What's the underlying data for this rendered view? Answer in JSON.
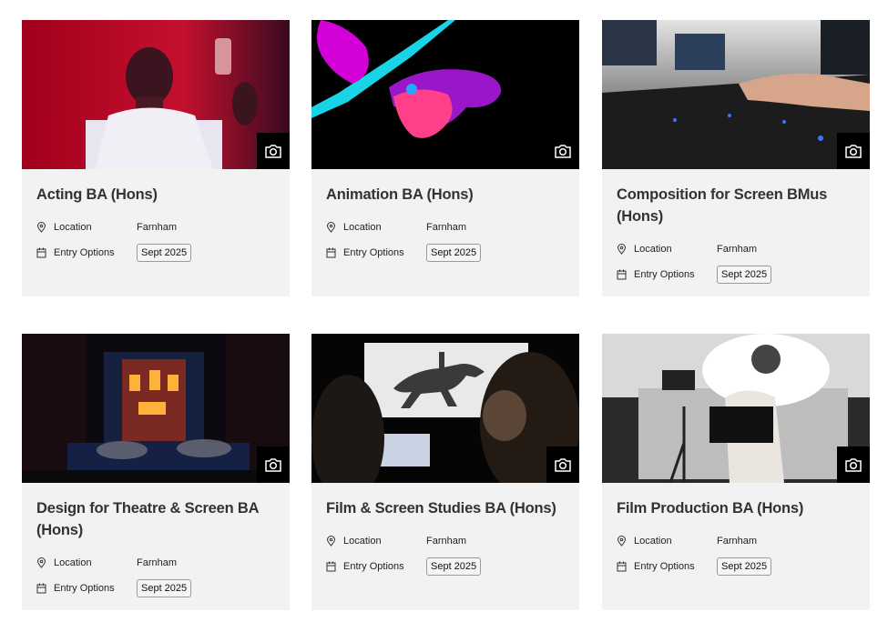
{
  "courses": [
    {
      "title": "Acting BA (Hons)",
      "location_label": "Location",
      "location_value": "Farnham",
      "entry_label": "Entry Options",
      "entry_value": "Sept 2025"
    },
    {
      "title": "Animation BA (Hons)",
      "location_label": "Location",
      "location_value": "Farnham",
      "entry_label": "Entry Options",
      "entry_value": "Sept 2025"
    },
    {
      "title": "Composition for Screen BMus (Hons)",
      "location_label": "Location",
      "location_value": "Farnham",
      "entry_label": "Entry Options",
      "entry_value": "Sept 2025"
    },
    {
      "title": "Design for Theatre & Screen BA (Hons)",
      "location_label": "Location",
      "location_value": "Farnham",
      "entry_label": "Entry Options",
      "entry_value": "Sept 2025"
    },
    {
      "title": "Film & Screen Studies BA (Hons)",
      "location_label": "Location",
      "location_value": "Farnham",
      "entry_label": "Entry Options",
      "entry_value": "Sept 2025"
    },
    {
      "title": "Film Production BA (Hons)",
      "location_label": "Location",
      "location_value": "Farnham",
      "entry_label": "Entry Options",
      "entry_value": "Sept 2025"
    }
  ],
  "icons": {
    "photo": "camera-icon",
    "location": "map-pin-icon",
    "entry": "calendar-icon"
  }
}
